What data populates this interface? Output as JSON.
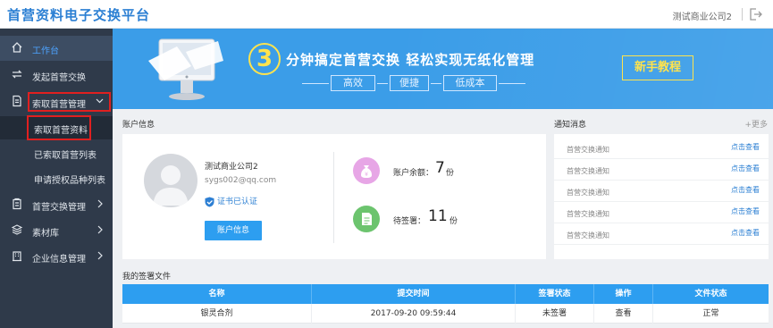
{
  "header": {
    "app_title": "首营资料电子交换平台",
    "company": "测试商业公司2",
    "logout_icon": "logout-icon"
  },
  "sidebar": {
    "items": [
      {
        "label": "工作台",
        "icon": "home-icon"
      },
      {
        "label": "发起首营交换",
        "icon": "exchange-icon"
      },
      {
        "label": "索取首营管理",
        "icon": "document-request-icon"
      },
      {
        "label": "首营交换管理",
        "icon": "clipboard-icon"
      },
      {
        "label": "素材库",
        "icon": "layers-icon"
      },
      {
        "label": "企业信息管理",
        "icon": "building-icon"
      }
    ],
    "sub_items": [
      {
        "label": "索取首营资料"
      },
      {
        "label": "已索取首营列表"
      },
      {
        "label": "申请授权品种列表"
      }
    ]
  },
  "banner": {
    "number": "3",
    "slogan": "分钟搞定首营交换   轻松实现无纸化管理",
    "tags": [
      "高效",
      "便捷",
      "低成本"
    ],
    "guide_button": "新手教程"
  },
  "account": {
    "section_title": "账户信息",
    "name": "测试商业公司2",
    "email": "sygs002@qq.com",
    "cert_status": "证书已认证",
    "button": "账户信息",
    "balance_label": "账户余额：",
    "balance_value": "7",
    "balance_unit": "份",
    "pending_label": "待签署：",
    "pending_value": "11",
    "pending_unit": "份"
  },
  "notices": {
    "section_title": "通知消息",
    "more": "+更多",
    "items": [
      {
        "title": "首营交换通知",
        "link": "点击查看"
      },
      {
        "title": "首营交换通知",
        "link": "点击查看"
      },
      {
        "title": "首营交换通知",
        "link": "点击查看"
      },
      {
        "title": "首营交换通知",
        "link": "点击查看"
      },
      {
        "title": "首营交换通知",
        "link": "点击查看"
      }
    ]
  },
  "files": {
    "section_title": "我的签署文件",
    "columns": [
      "名称",
      "提交时间",
      "签署状态",
      "操作",
      "文件状态"
    ],
    "rows": [
      {
        "name": "银灵合剂",
        "time": "2017-09-20 09:59:44",
        "sign_status": "未签署",
        "action": "查看",
        "file_status": "正常"
      }
    ]
  },
  "colors": {
    "accent": "#2d9ef0",
    "sidebar_bg": "#2f3a4a",
    "highlight": "#e02020",
    "banner_bg": "#3b9de8"
  }
}
